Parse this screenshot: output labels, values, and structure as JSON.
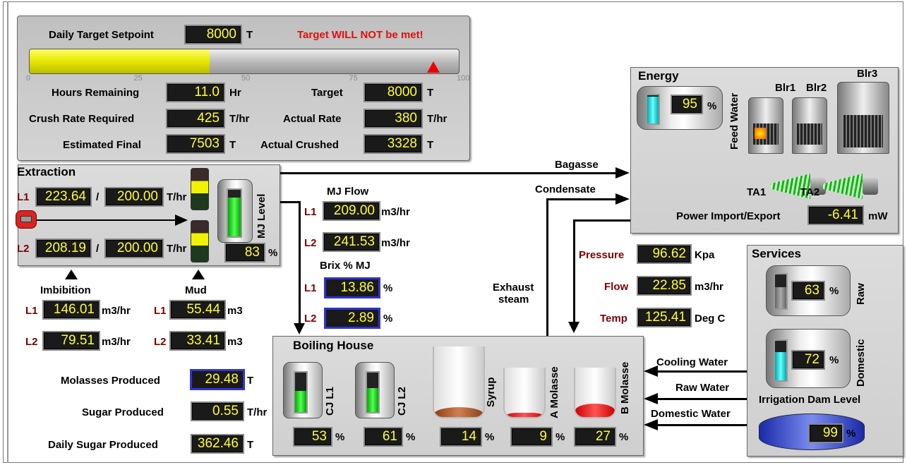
{
  "target": {
    "setpoint_label": "Daily Target Setpoint",
    "setpoint": "8000",
    "setpoint_unit": "T",
    "warning": "Target WILL NOT be met!",
    "progress": 0.42,
    "marker": 0.94,
    "scale": [
      "0",
      "25",
      "50",
      "75",
      "100"
    ],
    "hours_label": "Hours Remaining",
    "hours": "11.0",
    "hours_unit": "Hr",
    "crush_label": "Crush Rate Required",
    "crush": "425",
    "crush_unit": "T/hr",
    "est_label": "Estimated Final",
    "est": "7503",
    "est_unit": "T",
    "tgt_label": "Target",
    "tgt": "8000",
    "tgt_unit": "T",
    "rate_label": "Actual Rate",
    "rate": "380",
    "rate_unit": "T/hr",
    "crushed_label": "Actual Crushed",
    "crushed": "3328",
    "crushed_unit": "T"
  },
  "extraction": {
    "title": "Extraction",
    "l1": "L1",
    "l1_val": "223.64",
    "l1_set": "200.00",
    "l2": "L2",
    "l2_val": "208.19",
    "l2_set": "200.00",
    "slash": "/",
    "unit": "T/hr",
    "mj_level_label": "MJ Level",
    "mj_level": "83",
    "mj_level_fill": 0.83,
    "pct": "%"
  },
  "imbibition": {
    "title": "Imbibition",
    "l1": "L1",
    "l1_val": "146.01",
    "l2": "L2",
    "l2_val": "79.51",
    "unit": "m3/hr"
  },
  "mud": {
    "title": "Mud",
    "l1": "L1",
    "l1_val": "55.44",
    "l2": "L2",
    "l2_val": "33.41",
    "unit": "m3"
  },
  "mjflow": {
    "title": "MJ Flow",
    "l1": "L1",
    "l1_val": "209.00",
    "l2": "L2",
    "l2_val": "241.53",
    "unit": "m3/hr",
    "brix_title": "Brix % MJ",
    "b1": "13.86",
    "b2": "2.89",
    "pct": "%"
  },
  "production": {
    "molasses_label": "Molasses Produced",
    "molasses": "29.48",
    "molasses_unit": "T",
    "sugar_label": "Sugar Produced",
    "sugar": "0.55",
    "sugar_unit": "T/hr",
    "daily_label": "Daily Sugar Produced",
    "daily": "362.46",
    "daily_unit": "T"
  },
  "boiling": {
    "title": "Boiling House",
    "tanks": [
      {
        "label": "CJ L1",
        "val": "53",
        "fill": 0.53
      },
      {
        "label": "CJ L2",
        "val": "61",
        "fill": 0.61
      },
      {
        "label": "Syrup",
        "val": "14",
        "fill": 0.14
      },
      {
        "label": "A Molasse",
        "val": "9",
        "fill": 0.09
      },
      {
        "label": "B Molasse",
        "val": "27",
        "fill": 0.27
      }
    ],
    "pct": "%"
  },
  "flows": {
    "bagasse": "Bagasse",
    "condensate": "Condensate",
    "exhaust1": "Exhaust",
    "exhaust2": "steam",
    "cooling": "Cooling Water",
    "raw": "Raw Water",
    "domestic": "Domestic Water"
  },
  "steam": {
    "pressure_label": "Pressure",
    "pressure": "96.62",
    "pressure_unit": "Kpa",
    "flow_label": "Flow",
    "flow": "22.85",
    "flow_unit": "m3/hr",
    "temp_label": "Temp",
    "temp": "125.41",
    "temp_unit": "Deg C"
  },
  "energy": {
    "title": "Energy",
    "feed_label": "Feed Water",
    "feed": "95",
    "feed_fill": 0.95,
    "pct": "%",
    "blr1": "Blr1",
    "blr2": "Blr2",
    "blr3": "Blr3",
    "ta1": "TA1",
    "ta2": "TA2",
    "power_label": "Power Import/Export",
    "power": "-6.41",
    "power_unit": "mW"
  },
  "services": {
    "title": "Services",
    "raw_label": "Raw",
    "raw": "63",
    "raw_fill": 0.63,
    "dom_label": "Domestic",
    "dom": "72",
    "dom_fill": 0.72,
    "dam_label": "Irrigation Dam Level",
    "dam": "99",
    "pct": "%"
  },
  "colors": {
    "yellow": "#ffff00",
    "green": "#22cc22",
    "teal": "#22cccc",
    "brown": "#b5622a",
    "red": "#e02020",
    "blue": "#3344cc"
  }
}
